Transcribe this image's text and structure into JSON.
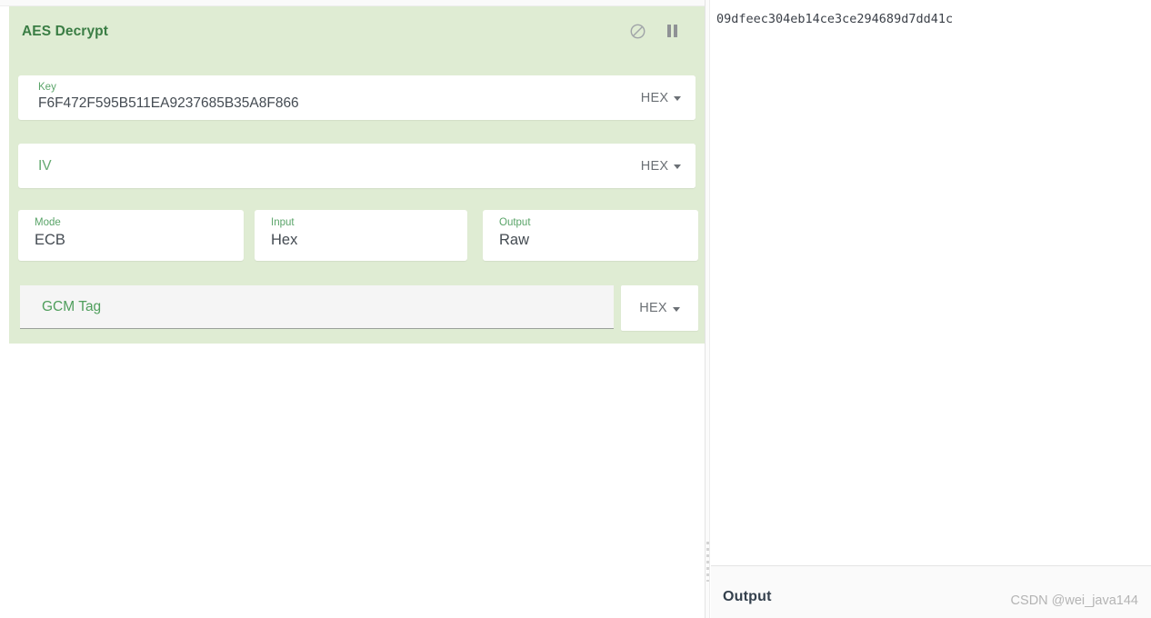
{
  "operation": {
    "title": "AES Decrypt",
    "header_icons": [
      {
        "name": "disable-icon",
        "glyph": "⊘"
      },
      {
        "name": "pause-icon",
        "glyph": ""
      }
    ],
    "fields": {
      "key": {
        "label": "Key",
        "value": "F6F472F595B511EA9237685B35A8F866",
        "unit": "HEX"
      },
      "iv": {
        "placeholder": "IV",
        "value": "",
        "unit": "HEX"
      },
      "gcm_tag": {
        "placeholder": "GCM Tag",
        "value": "",
        "unit": "HEX"
      }
    },
    "selects": [
      {
        "label": "Mode",
        "value": "ECB"
      },
      {
        "label": "Input",
        "value": "Hex"
      },
      {
        "label": "Output",
        "value": "Raw"
      }
    ]
  },
  "output": {
    "text": "09dfeec304eb14ce3ce294689d7dd41c",
    "footer_title": "Output"
  },
  "watermark": {
    "text": "CSDN @wei_java144"
  },
  "colors": {
    "panel_green": "#dfecd3",
    "title_green": "#3a7d44",
    "label_green": "#5aa469",
    "value_grey": "#444b52",
    "footer_grey": "#fafafa"
  }
}
